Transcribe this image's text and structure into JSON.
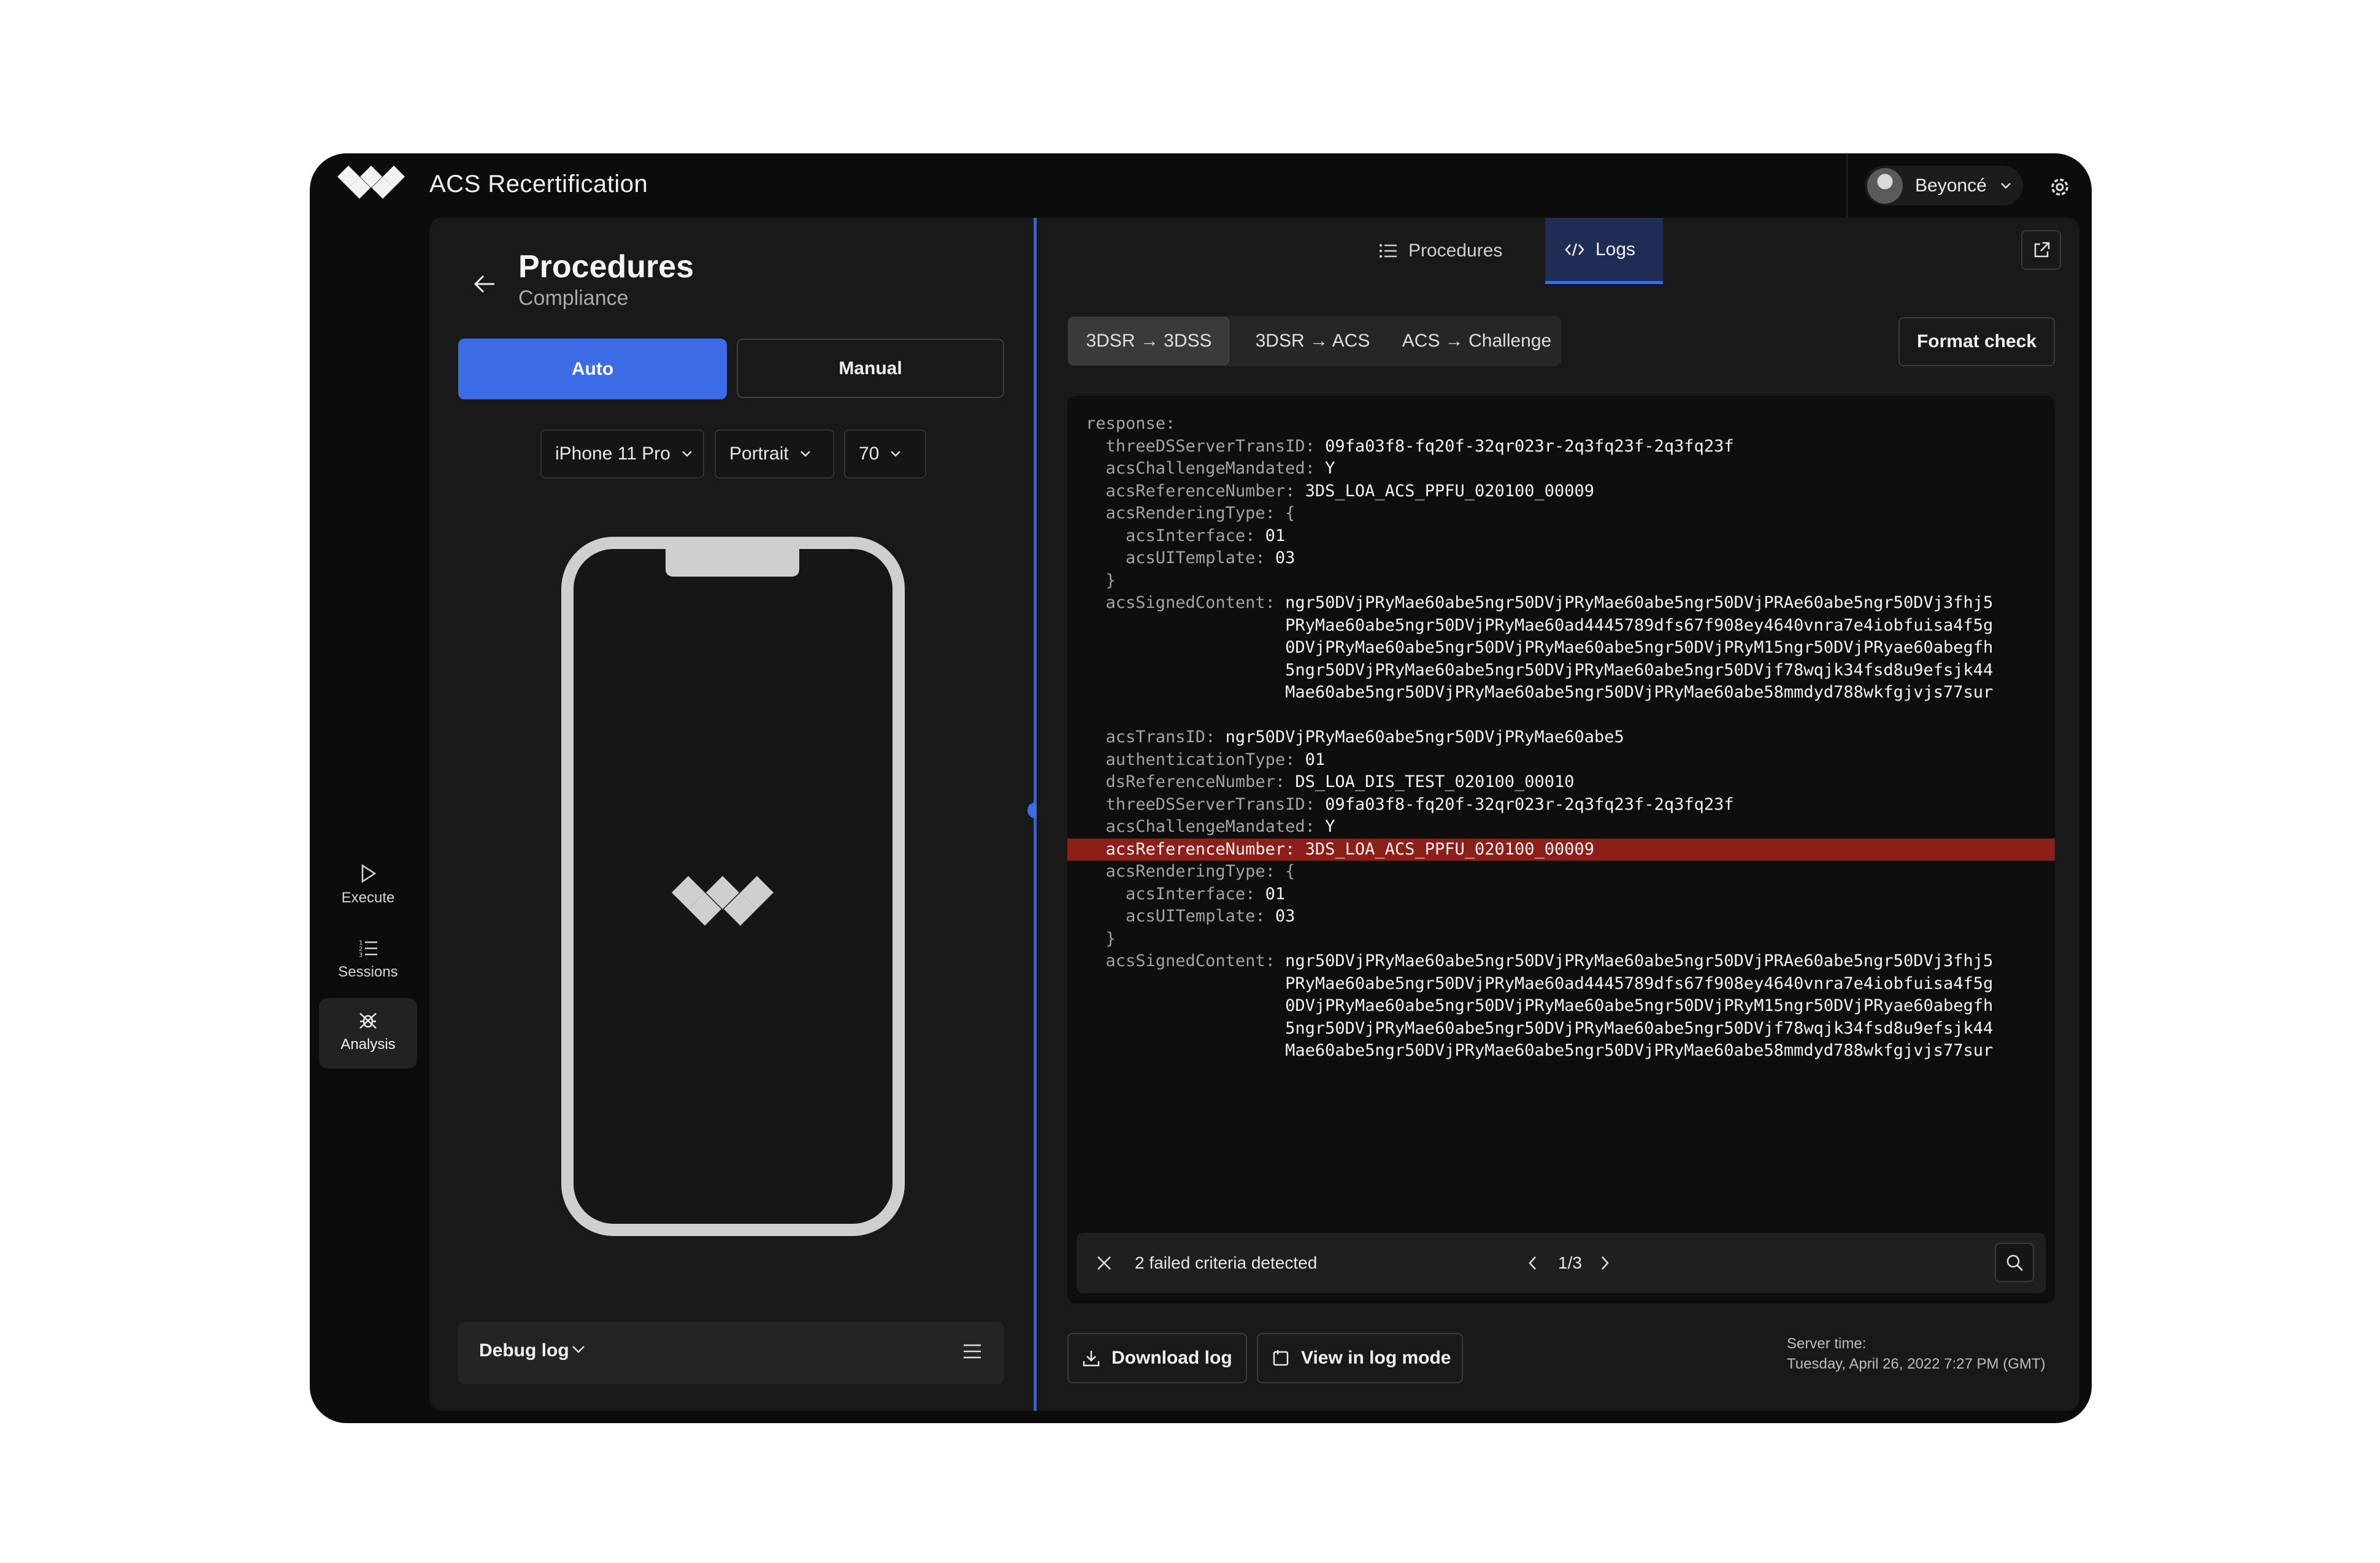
{
  "app": {
    "title": "ACS Recertification"
  },
  "user": {
    "name": "Beyoncé"
  },
  "rail": [
    {
      "label": "Execute",
      "icon": "play-icon"
    },
    {
      "label": "Sessions",
      "icon": "list-icon"
    },
    {
      "label": "Analysis",
      "icon": "bug-icon",
      "active": true
    }
  ],
  "left": {
    "title": "Procedures",
    "subtitle": "Compliance",
    "mode_auto": "Auto",
    "mode_manual": "Manual",
    "device": "iPhone 11 Pro",
    "orientation": "Portrait",
    "scale": "70",
    "debug_label": "Debug log"
  },
  "tabs": {
    "procedures": "Procedures",
    "logs": "Logs"
  },
  "segments": [
    "3DSR → 3DSS",
    "3DSR → ACS",
    "ACS → Challenge"
  ],
  "format_check": "Format check",
  "log_lines": [
    {
      "k": "response:",
      "v": ""
    },
    {
      "k": "  threeDSServerTransID: ",
      "v": "09fa03f8-fq20f-32qr023r-2q3fq23f-2q3fq23f"
    },
    {
      "k": "  acsChallengeMandated: ",
      "v": "Y"
    },
    {
      "k": "  acsReferenceNumber: ",
      "v": "3DS_LOA_ACS_PPFU_020100_00009"
    },
    {
      "k": "  acsRenderingType: {",
      "v": ""
    },
    {
      "k": "    acsInterface: ",
      "v": "01"
    },
    {
      "k": "    acsUITemplate: ",
      "v": "03"
    },
    {
      "k": "  }",
      "v": ""
    },
    {
      "k": "  acsSignedContent: ",
      "v": "ngr50DVjPRyMae60abe5ngr50DVjPRyMae60abe5ngr50DVjPRAe60abe5ngr50DVj3fhj5"
    },
    {
      "k": "                    ",
      "v": "PRyMae60abe5ngr50DVjPRyMae60ad4445789dfs67f908ey4640vnra7e4iobfuisa4f5g"
    },
    {
      "k": "                    ",
      "v": "0DVjPRyMae60abe5ngr50DVjPRyMae60abe5ngr50DVjPRyM15ngr50DVjPRyae60abegfh"
    },
    {
      "k": "                    ",
      "v": "5ngr50DVjPRyMae60abe5ngr50DVjPRyMae60abe5ngr50DVjf78wqjk34fsd8u9efsjk44"
    },
    {
      "k": "                    ",
      "v": "Mae60abe5ngr50DVjPRyMae60abe5ngr50DVjPRyMae60abe58mmdyd788wkfgjvjs77sur"
    },
    {
      "k": "",
      "v": ""
    },
    {
      "k": "  acsTransID: ",
      "v": "ngr50DVjPRyMae60abe5ngr50DVjPRyMae60abe5"
    },
    {
      "k": "  authenticationType: ",
      "v": "01"
    },
    {
      "k": "  dsReferenceNumber: ",
      "v": "DS_LOA_DIS_TEST_020100_00010"
    },
    {
      "k": "  threeDSServerTransID: ",
      "v": "09fa03f8-fq20f-32qr023r-2q3fq23f-2q3fq23f"
    },
    {
      "k": "  acsChallengeMandated: ",
      "v": "Y"
    },
    {
      "k": "  acsReferenceNumber: ",
      "v": "3DS_LOA_ACS_PPFU_020100_00009",
      "hl": true
    },
    {
      "k": "  acsRenderingType: {",
      "v": ""
    },
    {
      "k": "    acsInterface: ",
      "v": "01"
    },
    {
      "k": "    acsUITemplate: ",
      "v": "03"
    },
    {
      "k": "  }",
      "v": ""
    },
    {
      "k": "  acsSignedContent: ",
      "v": "ngr50DVjPRyMae60abe5ngr50DVjPRyMae60abe5ngr50DVjPRAe60abe5ngr50DVj3fhj5"
    },
    {
      "k": "                    ",
      "v": "PRyMae60abe5ngr50DVjPRyMae60ad4445789dfs67f908ey4640vnra7e4iobfuisa4f5g"
    },
    {
      "k": "                    ",
      "v": "0DVjPRyMae60abe5ngr50DVjPRyMae60abe5ngr50DVjPRyM15ngr50DVjPRyae60abegfh"
    },
    {
      "k": "                    ",
      "v": "5ngr50DVjPRyMae60abe5ngr50DVjPRyMae60abe5ngr50DVjf78wqjk34fsd8u9efsjk44"
    },
    {
      "k": "                    ",
      "v": "Mae60abe5ngr50DVjPRyMae60abe5ngr50DVjPRyMae60abe58mmdyd788wkfgjvjs77sur"
    }
  ],
  "find": {
    "message": "2 failed criteria detected",
    "count": "1/3"
  },
  "footer": {
    "download": "Download log",
    "view_mode": "View in log mode",
    "server_label": "Server time:",
    "server_time": "Tuesday, April 26, 2022 7:27 PM (GMT)"
  },
  "colors": {
    "accent": "#3b6ce6",
    "highlight": "#8c1f1a",
    "background": "#0c0c0c"
  }
}
